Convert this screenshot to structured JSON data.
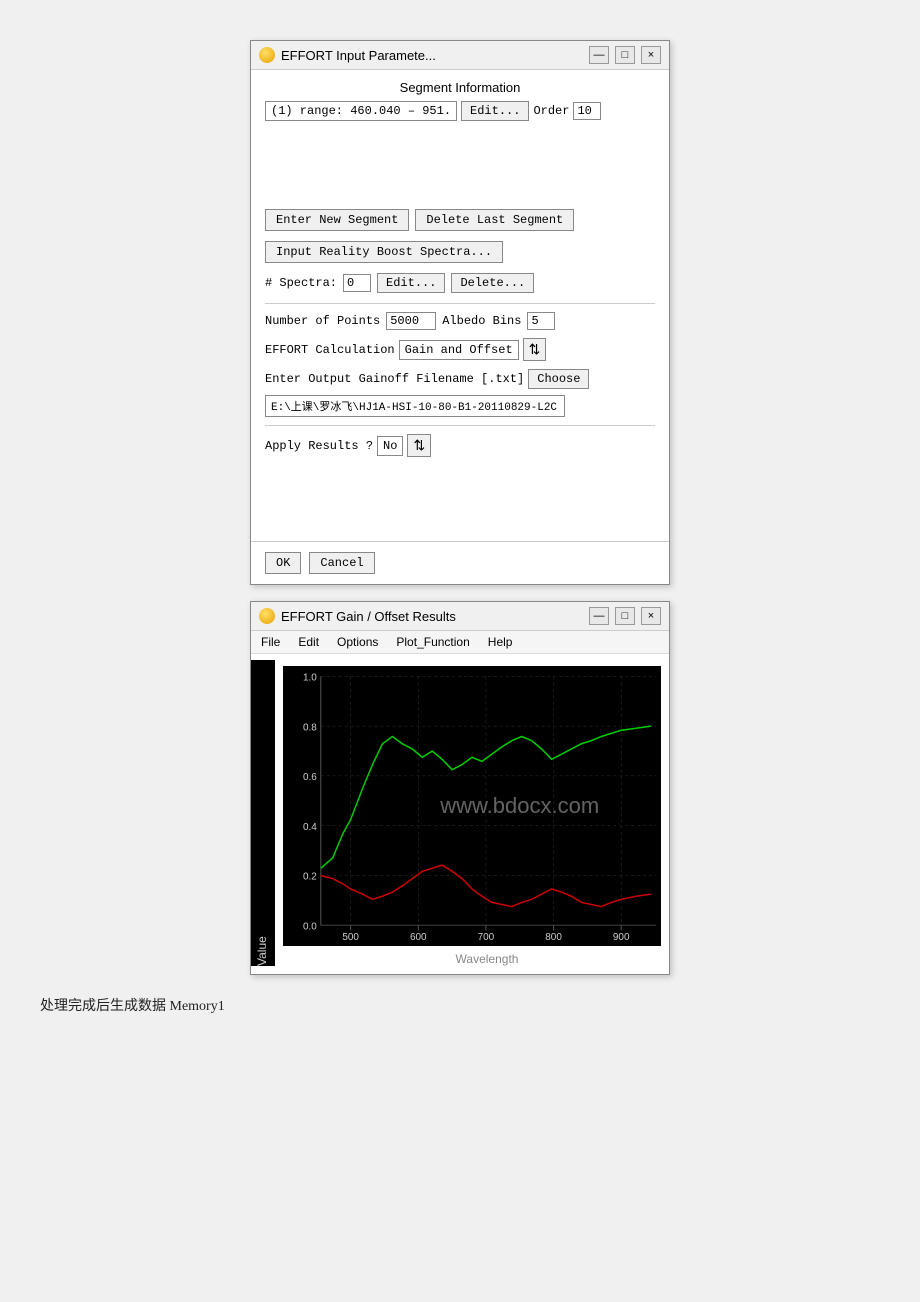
{
  "dialog1": {
    "title": "EFFORT Input Paramete...",
    "title_btns": [
      "—",
      "□",
      "×"
    ],
    "section_label": "Segment Information",
    "segment_text": "(1) range: 460.040 – 951.",
    "edit_btn": "Edit...",
    "order_label": "Order",
    "order_value": "10",
    "enter_segment_btn": "Enter New Segment",
    "delete_segment_btn": "Delete Last Segment",
    "input_reality_btn": "Input Reality Boost Spectra...",
    "spectra_label": "# Spectra:",
    "spectra_value": "0",
    "edit_spectra_btn": "Edit...",
    "delete_spectra_btn": "Delete...",
    "points_label": "Number of Points",
    "points_value": "5000",
    "albedo_label": "Albedo Bins",
    "albedo_value": "5",
    "calc_label": "EFFORT Calculation",
    "calc_value": "Gain and Offset",
    "sort_icon": "⇅",
    "output_label": "Enter Output Gainoff Filename [.txt]",
    "choose_btn": "Choose",
    "filename_value": "E:\\上课\\罗冰飞\\HJ1A-HSI-10-80-B1-20110829-L2C",
    "apply_label": "Apply Results ?",
    "apply_value": "No",
    "apply_sort_icon": "⇅",
    "ok_btn": "OK",
    "cancel_btn": "Cancel"
  },
  "dialog2": {
    "title": "EFFORT Gain / Offset Results",
    "title_btns": [
      "—",
      "□",
      "×"
    ],
    "menu_items": [
      "File",
      "Edit",
      "Options",
      "Plot_Function",
      "Help"
    ],
    "chart": {
      "x_label": "Wavelength",
      "y_label": "Value",
      "x_ticks": [
        "500",
        "600",
        "700",
        "800",
        "900"
      ],
      "y_ticks": [
        "0.0",
        "0.2",
        "0.4",
        "0.6",
        "0.8",
        "1.0"
      ]
    }
  },
  "caption": "处理完成后生成数据 Memory1",
  "watermark": "www.bdocx.com"
}
